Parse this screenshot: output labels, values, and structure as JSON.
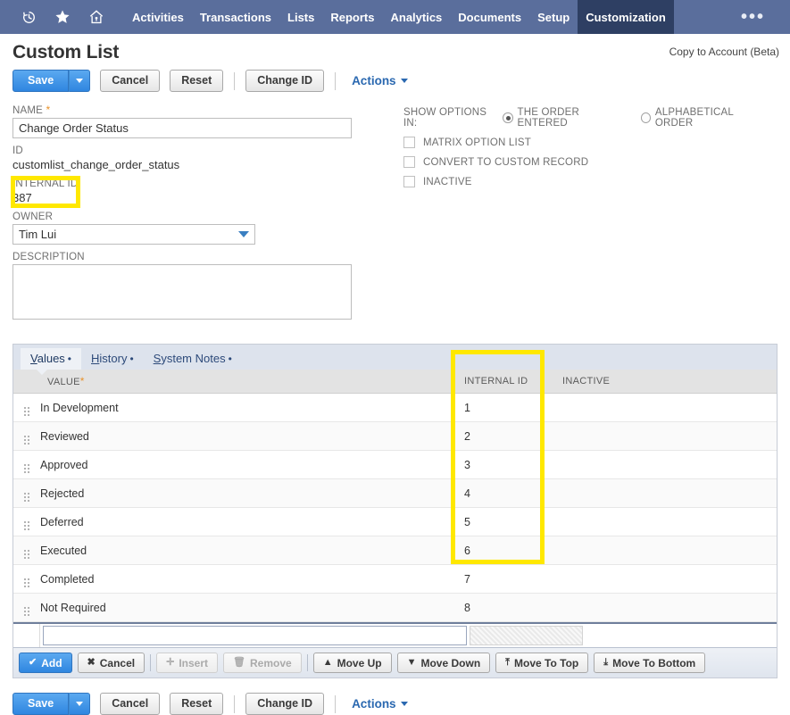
{
  "topnav": {
    "icons": [
      {
        "name": "recent-records-icon",
        "glyph": "history"
      },
      {
        "name": "favorites-icon",
        "glyph": "star"
      },
      {
        "name": "home-icon",
        "glyph": "home"
      }
    ],
    "items": [
      {
        "label": "Activities",
        "active": false
      },
      {
        "label": "Transactions",
        "active": false
      },
      {
        "label": "Lists",
        "active": false
      },
      {
        "label": "Reports",
        "active": false
      },
      {
        "label": "Analytics",
        "active": false
      },
      {
        "label": "Documents",
        "active": false
      },
      {
        "label": "Setup",
        "active": false
      },
      {
        "label": "Customization",
        "active": true
      }
    ],
    "more_label": "•••",
    "bg_color": "#5a6e9c",
    "active_bg_color": "#2e3f63"
  },
  "header": {
    "title": "Custom List",
    "copy_to_account": "Copy to Account (Beta)"
  },
  "toolbar": {
    "save_label": "Save",
    "cancel_label": "Cancel",
    "reset_label": "Reset",
    "change_id_label": "Change ID",
    "actions_label": "Actions"
  },
  "form": {
    "name_label": "NAME",
    "name_value": "Change Order Status",
    "name_required": "*",
    "id_label": "ID",
    "id_value": "customlist_change_order_status",
    "internal_id_label": "INTERNAL ID",
    "internal_id_value": "387",
    "owner_label": "OWNER",
    "owner_value": "Tim Lui",
    "description_label": "DESCRIPTION",
    "description_value": ""
  },
  "options": {
    "show_options_label": "SHOW OPTIONS IN:",
    "order_entered_label": "THE ORDER ENTERED",
    "order_entered_selected": true,
    "alphabetical_label": "ALPHABETICAL ORDER",
    "alphabetical_selected": false,
    "checkboxes": [
      {
        "label": "MATRIX OPTION LIST",
        "checked": false
      },
      {
        "label": "CONVERT TO CUSTOM RECORD",
        "checked": false
      },
      {
        "label": "INACTIVE",
        "checked": false
      }
    ]
  },
  "sublist": {
    "tabs": [
      {
        "label": "Values",
        "accesskey": "V",
        "active": true
      },
      {
        "label": "History",
        "accesskey": "H",
        "active": false
      },
      {
        "label": "System Notes",
        "accesskey": "S",
        "active": false
      }
    ],
    "columns": {
      "value": "VALUE",
      "value_required": "*",
      "internal_id": "INTERNAL ID",
      "inactive": "INACTIVE"
    },
    "rows": [
      {
        "value": "In Development",
        "internal_id": "1",
        "inactive": ""
      },
      {
        "value": "Reviewed",
        "internal_id": "2",
        "inactive": ""
      },
      {
        "value": "Approved",
        "internal_id": "3",
        "inactive": ""
      },
      {
        "value": "Rejected",
        "internal_id": "4",
        "inactive": ""
      },
      {
        "value": "Deferred",
        "internal_id": "5",
        "inactive": ""
      },
      {
        "value": "Executed",
        "internal_id": "6",
        "inactive": ""
      },
      {
        "value": "Completed",
        "internal_id": "7",
        "inactive": ""
      },
      {
        "value": "Not Required",
        "internal_id": "8",
        "inactive": ""
      }
    ],
    "new_row_value": "",
    "buttons": [
      {
        "label": "Add",
        "icon": "check-icon",
        "glyph": "✔",
        "state": "primary"
      },
      {
        "label": "Cancel",
        "icon": "x-icon",
        "glyph": "✖",
        "state": "normal"
      },
      {
        "label": "Insert",
        "icon": "plus-icon",
        "glyph": "✛",
        "state": "disabled"
      },
      {
        "label": "Remove",
        "icon": "trash-icon",
        "glyph": "🗑",
        "state": "disabled"
      },
      {
        "label": "Move Up",
        "icon": "arrow-up-icon",
        "glyph": "▲",
        "state": "normal"
      },
      {
        "label": "Move Down",
        "icon": "arrow-down-icon",
        "glyph": "▼",
        "state": "normal"
      },
      {
        "label": "Move To Top",
        "icon": "move-to-top-icon",
        "glyph": "⤒",
        "state": "normal"
      },
      {
        "label": "Move To Bottom",
        "icon": "move-to-bottom-icon",
        "glyph": "⤓",
        "state": "normal"
      }
    ]
  },
  "highlights": {
    "internal_id_field": "#ffe800",
    "internal_id_column": "#ffe800"
  }
}
